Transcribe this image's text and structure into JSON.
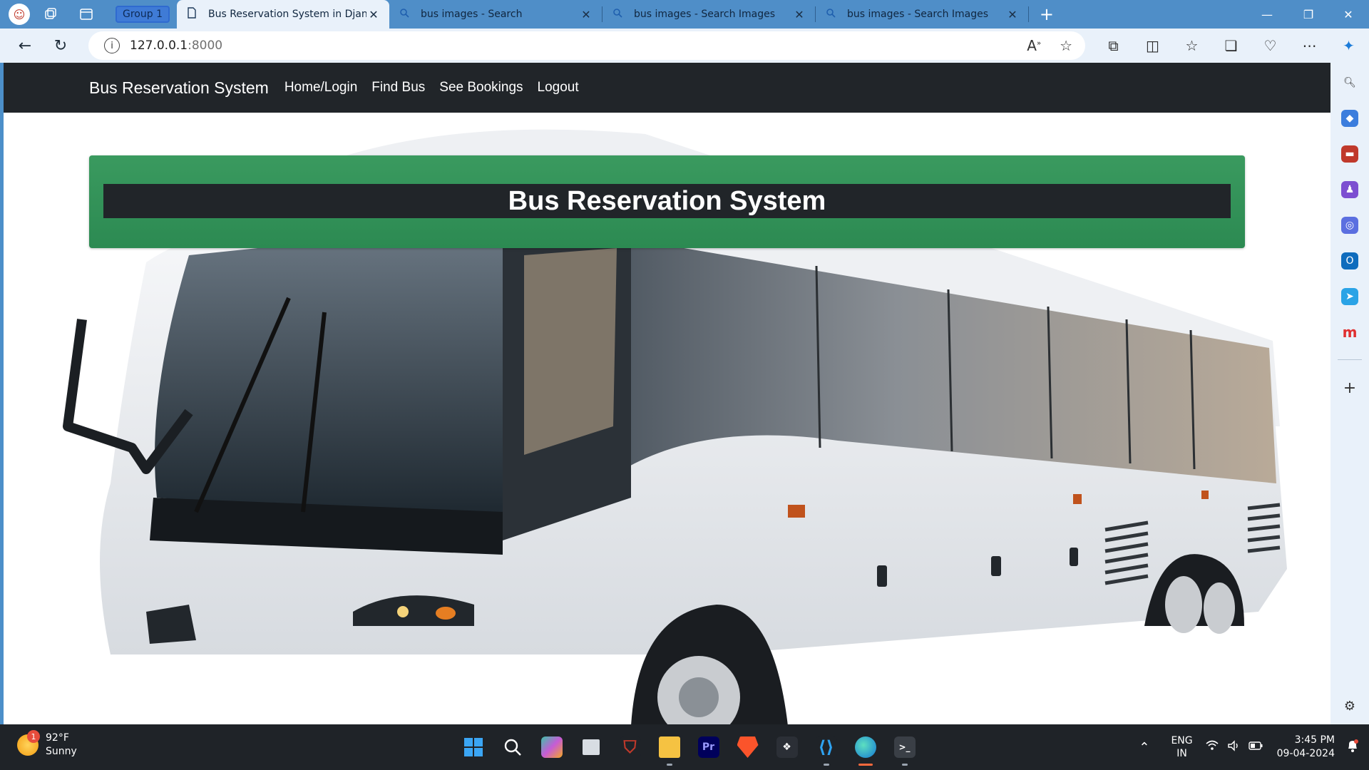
{
  "browser": {
    "group_label": "Group 1",
    "tabs": [
      {
        "title": "Bus Reservation System in Djang",
        "active": true,
        "icon": "page-icon"
      },
      {
        "title": "bus images - Search",
        "active": false,
        "icon": "search-icon"
      },
      {
        "title": "bus images - Search Images",
        "active": false,
        "icon": "search-icon"
      },
      {
        "title": "bus images - Search Images",
        "active": false,
        "icon": "search-icon"
      }
    ],
    "url_host": "127.0.0.1",
    "url_port": ":8000"
  },
  "site": {
    "brand": "Bus Reservation System",
    "nav": [
      "Home/Login",
      "Find Bus",
      "See Bookings",
      "Logout"
    ],
    "hero_title": "Bus Reservation System"
  },
  "taskbar": {
    "weather_temp": "92°F",
    "weather_desc": "Sunny",
    "weather_badge": "1",
    "lang_line1": "ENG",
    "lang_line2": "IN",
    "time": "3:45 PM",
    "date": "09-04-2024",
    "apps": [
      {
        "name": "start-icon",
        "label": ""
      },
      {
        "name": "search-icon",
        "label": ""
      },
      {
        "name": "copilot-icon",
        "label": ""
      },
      {
        "name": "task-view-icon",
        "label": ""
      },
      {
        "name": "mcafee-icon",
        "label": ""
      },
      {
        "name": "file-explorer-icon",
        "label": ""
      },
      {
        "name": "premiere-pro-icon",
        "label": "Pr"
      },
      {
        "name": "brave-icon",
        "label": ""
      },
      {
        "name": "davinci-resolve-icon",
        "label": ""
      },
      {
        "name": "vscode-icon",
        "label": ""
      },
      {
        "name": "edge-icon",
        "label": ""
      },
      {
        "name": "terminal-icon",
        "label": ""
      }
    ]
  },
  "colors": {
    "navbar": "#212529",
    "hero_green": "#2c8a52",
    "tabbar": "#4f8ec8",
    "taskbar": "#1f2328"
  }
}
